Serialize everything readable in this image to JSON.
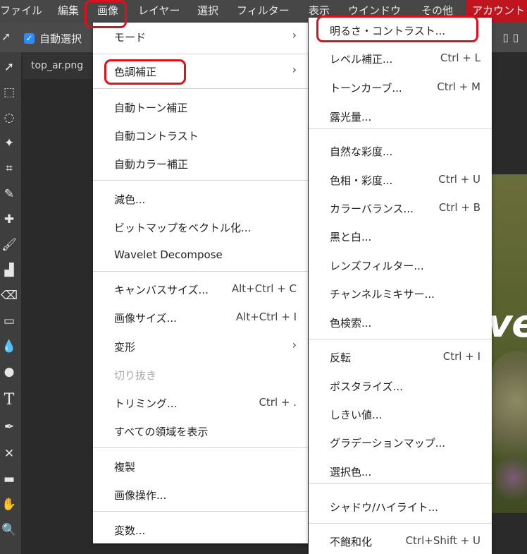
{
  "menubar": {
    "items": [
      "ファイル",
      "編集",
      "画像",
      "レイヤー",
      "選択",
      "フィルター",
      "表示",
      "ウインドウ",
      "その他"
    ],
    "account": "アカウント"
  },
  "options_bar": {
    "auto_select_label": "自動選択"
  },
  "document": {
    "tab_name": "top_ar.png",
    "photo_text": "ve"
  },
  "image_menu": {
    "items": [
      {
        "label": "モード",
        "shortcut": "",
        "submenu": true
      },
      {
        "label": "色調補正",
        "shortcut": "",
        "submenu": true
      },
      {
        "label": "自動トーン補正",
        "shortcut": ""
      },
      {
        "label": "自動コントラスト",
        "shortcut": ""
      },
      {
        "label": "自動カラー補正",
        "shortcut": ""
      },
      {
        "label": "減色...",
        "shortcut": ""
      },
      {
        "label": "ビットマップをベクトル化...",
        "shortcut": ""
      },
      {
        "label": "Wavelet Decompose",
        "shortcut": ""
      },
      {
        "label": "キャンバスサイズ...",
        "shortcut": "Alt+Ctrl + C"
      },
      {
        "label": "画像サイズ...",
        "shortcut": "Alt+Ctrl + I"
      },
      {
        "label": "変形",
        "shortcut": "",
        "submenu": true
      },
      {
        "label": "切り抜き",
        "shortcut": "",
        "disabled": true
      },
      {
        "label": "トリミング...",
        "shortcut": "Ctrl + ."
      },
      {
        "label": "すべての領域を表示",
        "shortcut": ""
      },
      {
        "label": "複製",
        "shortcut": ""
      },
      {
        "label": "画像操作...",
        "shortcut": ""
      },
      {
        "label": "変数...",
        "shortcut": ""
      }
    ]
  },
  "adjust_submenu": {
    "items": [
      {
        "label": "明るさ・コントラスト...",
        "shortcut": ""
      },
      {
        "label": "レベル補正...",
        "shortcut": "Ctrl + L"
      },
      {
        "label": "トーンカーブ...",
        "shortcut": "Ctrl + M"
      },
      {
        "label": "露光量...",
        "shortcut": ""
      },
      {
        "label": "自然な彩度...",
        "shortcut": ""
      },
      {
        "label": "色相・彩度...",
        "shortcut": "Ctrl + U"
      },
      {
        "label": "カラーバランス...",
        "shortcut": "Ctrl + B"
      },
      {
        "label": "黒と白...",
        "shortcut": ""
      },
      {
        "label": "レンズフィルター...",
        "shortcut": ""
      },
      {
        "label": "チャンネルミキサー...",
        "shortcut": ""
      },
      {
        "label": "色検索...",
        "shortcut": ""
      },
      {
        "label": "反転",
        "shortcut": "Ctrl + I"
      },
      {
        "label": "ポスタライズ...",
        "shortcut": ""
      },
      {
        "label": "しきい値...",
        "shortcut": ""
      },
      {
        "label": "グラデーションマップ...",
        "shortcut": ""
      },
      {
        "label": "選択色...",
        "shortcut": ""
      },
      {
        "label": "シャドウ/ハイライト...",
        "shortcut": ""
      },
      {
        "label": "不飽和化",
        "shortcut": "Ctrl+Shift + U"
      }
    ]
  },
  "colors": {
    "accent_red": "#e0101a",
    "account_bg": "#c0141e",
    "checkbox_blue": "#2e8af5"
  },
  "icons": [
    "move-tool-icon",
    "marquee-tool-icon",
    "lasso-tool-icon",
    "magic-wand-icon",
    "crop-tool-icon",
    "eyedropper-icon",
    "healing-brush-icon",
    "brush-tool-icon",
    "stamp-tool-icon",
    "eraser-icon",
    "gradient-tool-icon",
    "blur-tool-icon",
    "dodge-tool-icon",
    "type-tool-icon",
    "pen-tool-icon",
    "path-select-icon",
    "shape-tool-icon",
    "hand-tool-icon",
    "zoom-tool-icon"
  ]
}
